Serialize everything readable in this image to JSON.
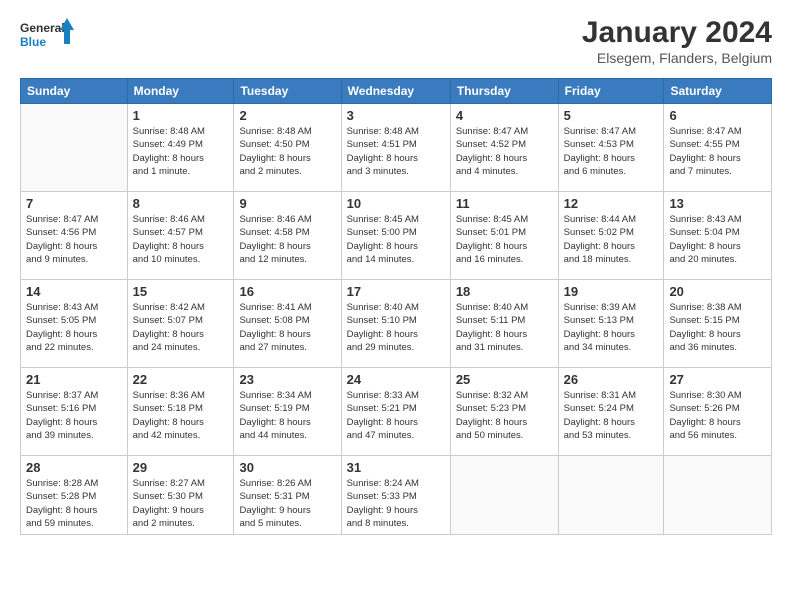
{
  "logo": {
    "text_general": "General",
    "text_blue": "Blue"
  },
  "header": {
    "month_year": "January 2024",
    "location": "Elsegem, Flanders, Belgium"
  },
  "weekdays": [
    "Sunday",
    "Monday",
    "Tuesday",
    "Wednesday",
    "Thursday",
    "Friday",
    "Saturday"
  ],
  "weeks": [
    [
      {
        "day": "",
        "info": ""
      },
      {
        "day": "1",
        "info": "Sunrise: 8:48 AM\nSunset: 4:49 PM\nDaylight: 8 hours\nand 1 minute."
      },
      {
        "day": "2",
        "info": "Sunrise: 8:48 AM\nSunset: 4:50 PM\nDaylight: 8 hours\nand 2 minutes."
      },
      {
        "day": "3",
        "info": "Sunrise: 8:48 AM\nSunset: 4:51 PM\nDaylight: 8 hours\nand 3 minutes."
      },
      {
        "day": "4",
        "info": "Sunrise: 8:47 AM\nSunset: 4:52 PM\nDaylight: 8 hours\nand 4 minutes."
      },
      {
        "day": "5",
        "info": "Sunrise: 8:47 AM\nSunset: 4:53 PM\nDaylight: 8 hours\nand 6 minutes."
      },
      {
        "day": "6",
        "info": "Sunrise: 8:47 AM\nSunset: 4:55 PM\nDaylight: 8 hours\nand 7 minutes."
      }
    ],
    [
      {
        "day": "7",
        "info": "Sunrise: 8:47 AM\nSunset: 4:56 PM\nDaylight: 8 hours\nand 9 minutes."
      },
      {
        "day": "8",
        "info": "Sunrise: 8:46 AM\nSunset: 4:57 PM\nDaylight: 8 hours\nand 10 minutes."
      },
      {
        "day": "9",
        "info": "Sunrise: 8:46 AM\nSunset: 4:58 PM\nDaylight: 8 hours\nand 12 minutes."
      },
      {
        "day": "10",
        "info": "Sunrise: 8:45 AM\nSunset: 5:00 PM\nDaylight: 8 hours\nand 14 minutes."
      },
      {
        "day": "11",
        "info": "Sunrise: 8:45 AM\nSunset: 5:01 PM\nDaylight: 8 hours\nand 16 minutes."
      },
      {
        "day": "12",
        "info": "Sunrise: 8:44 AM\nSunset: 5:02 PM\nDaylight: 8 hours\nand 18 minutes."
      },
      {
        "day": "13",
        "info": "Sunrise: 8:43 AM\nSunset: 5:04 PM\nDaylight: 8 hours\nand 20 minutes."
      }
    ],
    [
      {
        "day": "14",
        "info": "Sunrise: 8:43 AM\nSunset: 5:05 PM\nDaylight: 8 hours\nand 22 minutes."
      },
      {
        "day": "15",
        "info": "Sunrise: 8:42 AM\nSunset: 5:07 PM\nDaylight: 8 hours\nand 24 minutes."
      },
      {
        "day": "16",
        "info": "Sunrise: 8:41 AM\nSunset: 5:08 PM\nDaylight: 8 hours\nand 27 minutes."
      },
      {
        "day": "17",
        "info": "Sunrise: 8:40 AM\nSunset: 5:10 PM\nDaylight: 8 hours\nand 29 minutes."
      },
      {
        "day": "18",
        "info": "Sunrise: 8:40 AM\nSunset: 5:11 PM\nDaylight: 8 hours\nand 31 minutes."
      },
      {
        "day": "19",
        "info": "Sunrise: 8:39 AM\nSunset: 5:13 PM\nDaylight: 8 hours\nand 34 minutes."
      },
      {
        "day": "20",
        "info": "Sunrise: 8:38 AM\nSunset: 5:15 PM\nDaylight: 8 hours\nand 36 minutes."
      }
    ],
    [
      {
        "day": "21",
        "info": "Sunrise: 8:37 AM\nSunset: 5:16 PM\nDaylight: 8 hours\nand 39 minutes."
      },
      {
        "day": "22",
        "info": "Sunrise: 8:36 AM\nSunset: 5:18 PM\nDaylight: 8 hours\nand 42 minutes."
      },
      {
        "day": "23",
        "info": "Sunrise: 8:34 AM\nSunset: 5:19 PM\nDaylight: 8 hours\nand 44 minutes."
      },
      {
        "day": "24",
        "info": "Sunrise: 8:33 AM\nSunset: 5:21 PM\nDaylight: 8 hours\nand 47 minutes."
      },
      {
        "day": "25",
        "info": "Sunrise: 8:32 AM\nSunset: 5:23 PM\nDaylight: 8 hours\nand 50 minutes."
      },
      {
        "day": "26",
        "info": "Sunrise: 8:31 AM\nSunset: 5:24 PM\nDaylight: 8 hours\nand 53 minutes."
      },
      {
        "day": "27",
        "info": "Sunrise: 8:30 AM\nSunset: 5:26 PM\nDaylight: 8 hours\nand 56 minutes."
      }
    ],
    [
      {
        "day": "28",
        "info": "Sunrise: 8:28 AM\nSunset: 5:28 PM\nDaylight: 8 hours\nand 59 minutes."
      },
      {
        "day": "29",
        "info": "Sunrise: 8:27 AM\nSunset: 5:30 PM\nDaylight: 9 hours\nand 2 minutes."
      },
      {
        "day": "30",
        "info": "Sunrise: 8:26 AM\nSunset: 5:31 PM\nDaylight: 9 hours\nand 5 minutes."
      },
      {
        "day": "31",
        "info": "Sunrise: 8:24 AM\nSunset: 5:33 PM\nDaylight: 9 hours\nand 8 minutes."
      },
      {
        "day": "",
        "info": ""
      },
      {
        "day": "",
        "info": ""
      },
      {
        "day": "",
        "info": ""
      }
    ]
  ]
}
